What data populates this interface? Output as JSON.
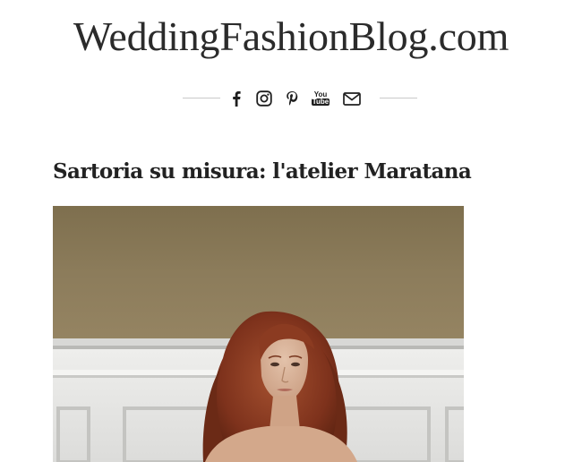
{
  "site": {
    "title": "WeddingFashionBlog.com"
  },
  "social": [
    {
      "icon": "facebook-icon"
    },
    {
      "icon": "instagram-icon"
    },
    {
      "icon": "pinterest-icon"
    },
    {
      "icon": "youtube-icon",
      "label_top": "You",
      "label_bottom": "Tube"
    },
    {
      "icon": "email-icon"
    }
  ],
  "post": {
    "title": "Sartoria su misura: l'atelier Maratana"
  },
  "colors": {
    "text": "#222222",
    "rule": "#c9c9c9",
    "wall_top": "#8a7a5a",
    "wainscot": "#e9e9e7",
    "hair": "#8a3a22"
  }
}
